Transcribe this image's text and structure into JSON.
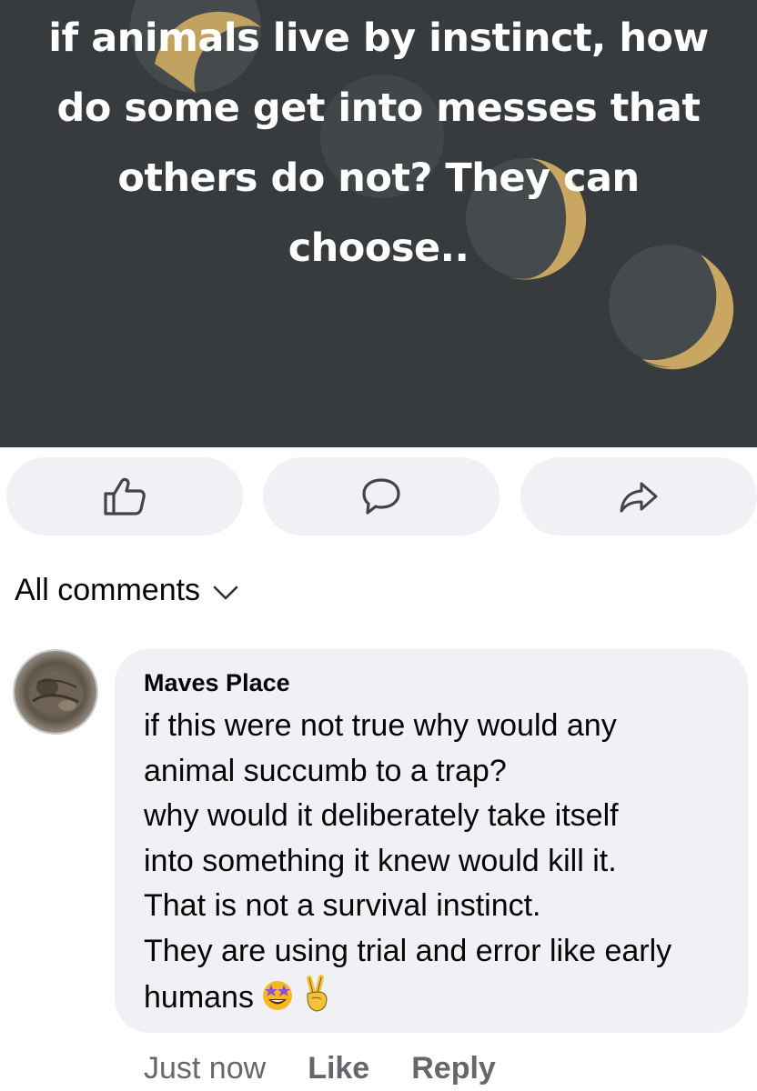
{
  "post": {
    "text": "if animals live by instinct, how do some get into messes that others do not? They can choose..",
    "lines": [
      "if animals live by instinct, how",
      "do some get into messes that",
      "others do not? They can",
      "choose.."
    ],
    "colors": {
      "background": "#373b3e",
      "moon_dark": "#454b4c",
      "moon_gold": "#c9a662"
    }
  },
  "actions": {
    "like_icon": "thumbs-up-icon",
    "comment_icon": "comment-bubble-icon",
    "share_icon": "share-arrow-icon"
  },
  "comments_header": {
    "label": "All comments",
    "icon": "chevron-down-icon"
  },
  "comment": {
    "author": "Maves Place",
    "lines": [
      "if this were not true why would any",
      "animal succumb to a trap?",
      "why would it deliberately take itself",
      "into something it knew would kill it.",
      "That is not a survival instinct.",
      "They are using trial and error like early",
      "humans"
    ],
    "emojis": [
      "star-struck-emoji",
      "victory-hand-emoji"
    ],
    "timestamp": "Just now",
    "like_label": "Like",
    "reply_label": "Reply"
  }
}
